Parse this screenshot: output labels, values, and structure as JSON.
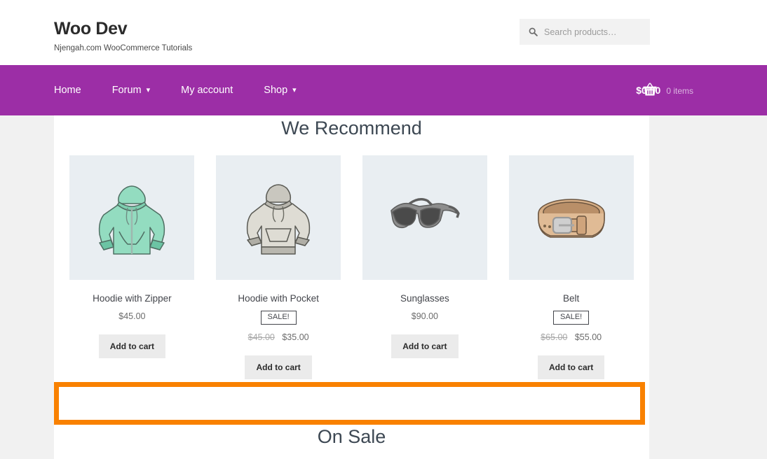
{
  "header": {
    "site_title": "Woo Dev",
    "tagline": "Njengah.com WooCommerce Tutorials",
    "search": {
      "placeholder": "Search products…",
      "value": "",
      "icon": "search-icon"
    }
  },
  "nav": {
    "items": [
      {
        "label": "Home",
        "has_dropdown": false
      },
      {
        "label": "Forum",
        "has_dropdown": true
      },
      {
        "label": "My account",
        "has_dropdown": false
      },
      {
        "label": "Shop",
        "has_dropdown": true
      }
    ],
    "chevron": "▾",
    "cart": {
      "amount": "$0.00",
      "count": "0 items",
      "icon": "shopping-basket-icon"
    },
    "background_color": "#9c2ea6"
  },
  "sections": {
    "recommend_heading": "We Recommend",
    "onsale_heading": "On Sale"
  },
  "products": [
    {
      "title": "Hoodie with Zipper",
      "image": "mint-zip-hoodie-image",
      "on_sale": false,
      "sale_label": "",
      "old_price": "",
      "price": "$45.00",
      "button": "Add to cart"
    },
    {
      "title": "Hoodie with Pocket",
      "image": "grey-pullover-hoodie-image",
      "on_sale": true,
      "sale_label": "SALE!",
      "old_price": "$45.00",
      "price": "$35.00",
      "button": "Add to cart"
    },
    {
      "title": "Sunglasses",
      "image": "sunglasses-image",
      "on_sale": false,
      "sale_label": "",
      "old_price": "",
      "price": "$90.00",
      "button": "Add to cart"
    },
    {
      "title": "Belt",
      "image": "leather-belt-image",
      "on_sale": true,
      "sale_label": "SALE!",
      "old_price": "$65.00",
      "price": "$55.00",
      "button": "Add to cart"
    }
  ],
  "highlight": {
    "color": "#f98100",
    "content": ""
  },
  "colors": {
    "nav_purple": "#9c2ea6",
    "page_background": "#f1f1f1",
    "content_background": "#ffffff",
    "thumb_background": "#e9eef2",
    "highlight_orange": "#f98100"
  }
}
